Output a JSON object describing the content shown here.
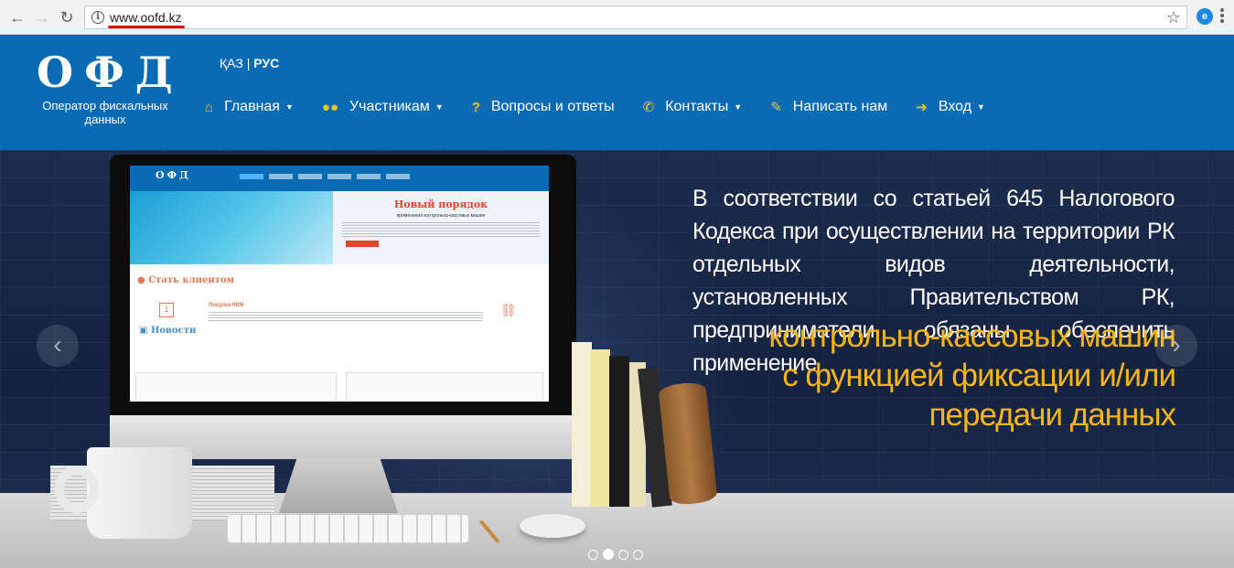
{
  "browser": {
    "url": "www.oofd.kz",
    "icons": [
      "back-arrow-icon",
      "forward-arrow-icon",
      "reload-icon",
      "info-icon",
      "star-icon",
      "extension-icon",
      "menu-icon"
    ]
  },
  "header": {
    "logo_title": "ОФД",
    "logo_subtitle": "Оператор фискальных данных",
    "lang_kaz": "ҚАЗ",
    "lang_sep": "|",
    "lang_rus": "РУС",
    "nav": [
      {
        "label": "Главная",
        "icon": "home-icon",
        "dropdown": true
      },
      {
        "label": "Участникам",
        "icon": "users-icon",
        "dropdown": true
      },
      {
        "label": "Вопросы и ответы",
        "icon": "question-icon",
        "dropdown": false
      },
      {
        "label": "Контакты",
        "icon": "phone-icon",
        "dropdown": true
      },
      {
        "label": "Написать нам",
        "icon": "edit-icon",
        "dropdown": false
      },
      {
        "label": "Вход",
        "icon": "sign-in-icon",
        "dropdown": true
      }
    ],
    "accent_color": "#f5c518",
    "bg_color": "#0a6bb5"
  },
  "hero": {
    "text": "В соответствии со статьей 645 Налогового Кодекса при осуществлении на территории РК отдельных видов деятельности, установленных Правительством РК, предприниматели обязаны обеспечить применение",
    "accent_lines": [
      "контрольно-кассовых машин",
      "с функцией фиксации и/или",
      "передачи данных"
    ],
    "accent_color": "#f9b515",
    "slide_count": 4,
    "active_slide": 2,
    "screen": {
      "logo": "ОФД",
      "slide_title": "Новый порядок",
      "slide_subtitle": "применения контрольно-кассовых машин",
      "section_title": "Стать клиентом",
      "step_number": "1",
      "step_title": "Покупка ККМ",
      "news_title": "Новости"
    }
  }
}
